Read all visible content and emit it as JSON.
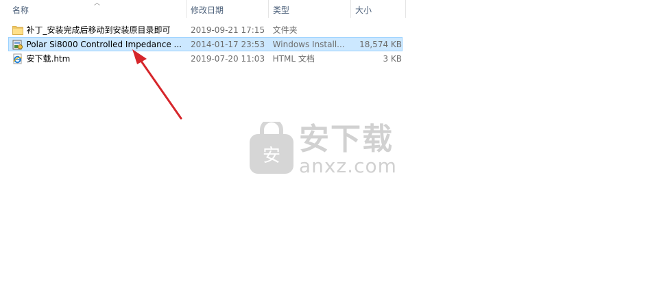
{
  "columns": {
    "name": "名称",
    "date": "修改日期",
    "type": "类型",
    "size": "大小"
  },
  "files": [
    {
      "icon": "folder-icon",
      "name": "补丁_安装完成后移动到安装原目录即可",
      "date": "2019-09-21 17:15",
      "type": "文件夹",
      "size": "",
      "selected": false
    },
    {
      "icon": "installer-icon",
      "name": "Polar Si8000 Controlled Impedance ...",
      "date": "2014-01-17 23:53",
      "type": "Windows Install...",
      "size": "18,574 KB",
      "selected": true
    },
    {
      "icon": "ie-html-icon",
      "name": "安下载.htm",
      "date": "2019-07-20 11:03",
      "type": "HTML 文档",
      "size": "3 KB",
      "selected": false
    }
  ],
  "watermark": {
    "badge": "安",
    "title": "安下载",
    "domain": "anxz.com"
  },
  "colors": {
    "selection_bg": "#cce8ff",
    "selection_border": "#99d1ff",
    "arrow": "#d6262b"
  }
}
